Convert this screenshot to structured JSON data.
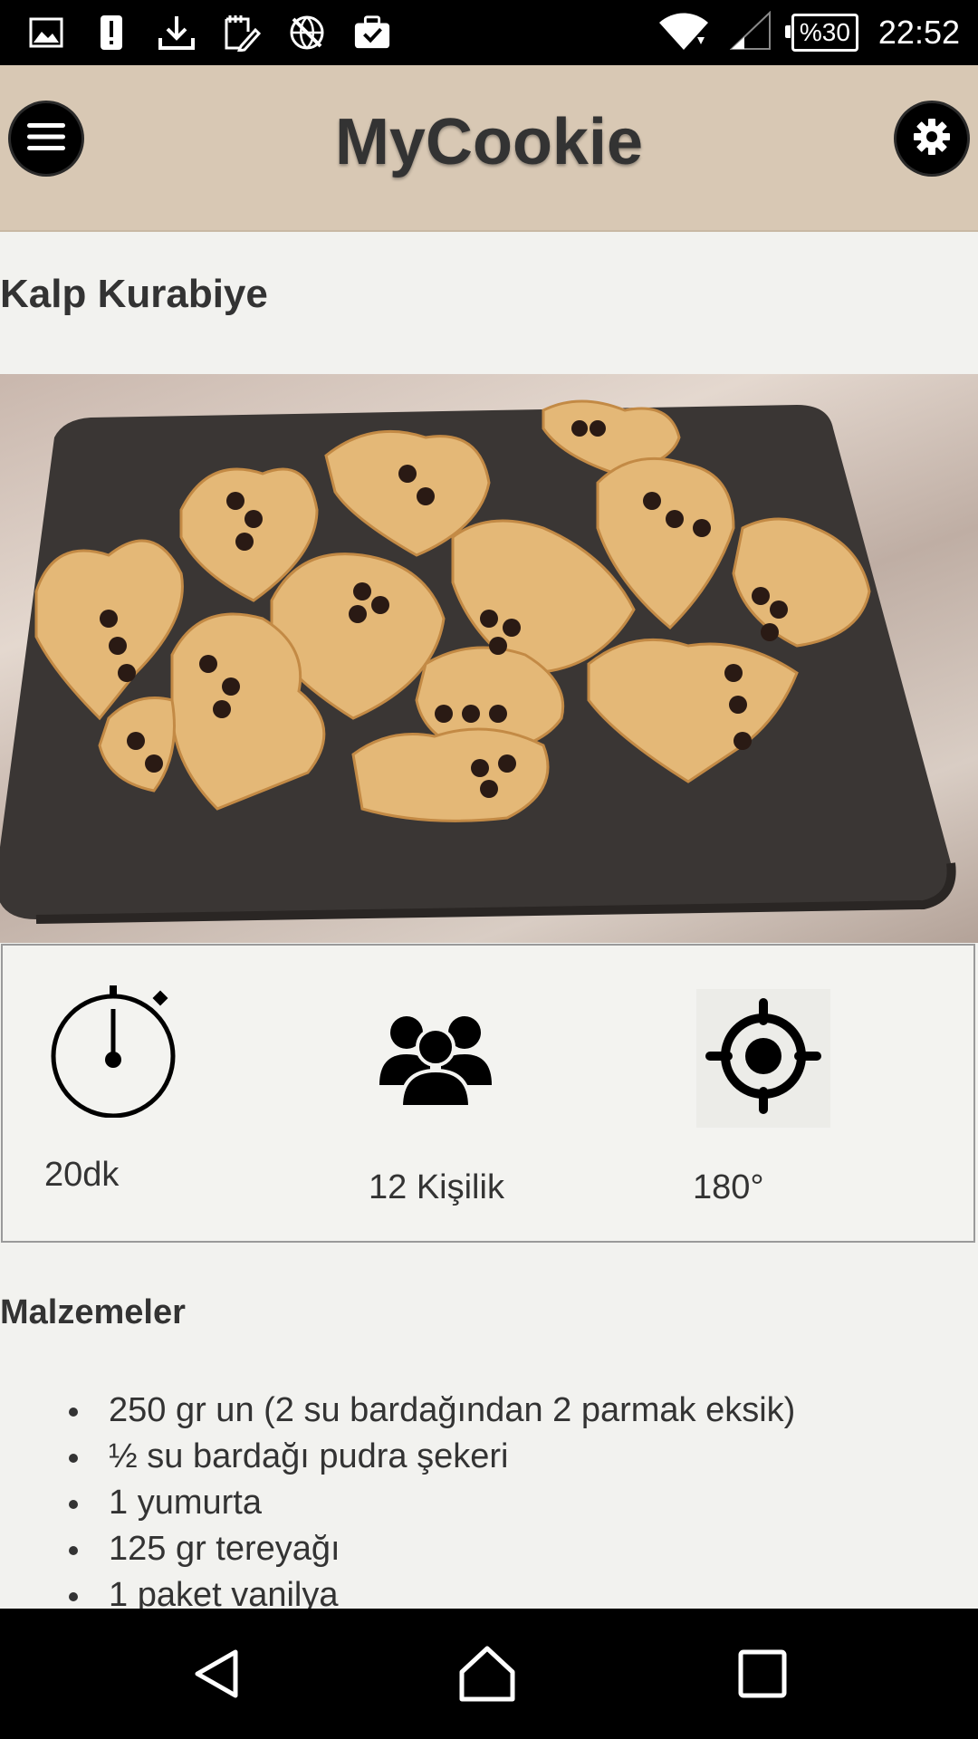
{
  "status_bar": {
    "battery": "%30",
    "time": "22:52",
    "icons": [
      "image-icon",
      "alert-icon",
      "download-icon",
      "note-edit-icon",
      "no-network-icon",
      "briefcase-check-icon",
      "wifi-icon",
      "signal-icon",
      "battery-icon"
    ]
  },
  "header": {
    "title": "MyCookie",
    "menu_icon": "hamburger-menu-icon",
    "settings_icon": "gear-icon"
  },
  "recipe": {
    "title": "Kalp Kurabiye",
    "photo_description": "heart cookies on dark plate",
    "info": {
      "time": "20dk",
      "servings": "12 Kişilik",
      "temperature": "180°"
    },
    "ingredients_title": "Malzemeler",
    "ingredients": [
      "250 gr un (2 su bardağından 2 parmak eksik)",
      "½ su bardağı pudra şekeri",
      "1 yumurta",
      "125 gr tereyağı",
      "1 paket vanilya"
    ]
  },
  "nav": {
    "icons": [
      "back-icon",
      "home-icon",
      "recents-icon"
    ]
  },
  "colors": {
    "header_bg": "#d8c8b4",
    "page_bg": "#f2f2ef",
    "text": "#333333"
  }
}
